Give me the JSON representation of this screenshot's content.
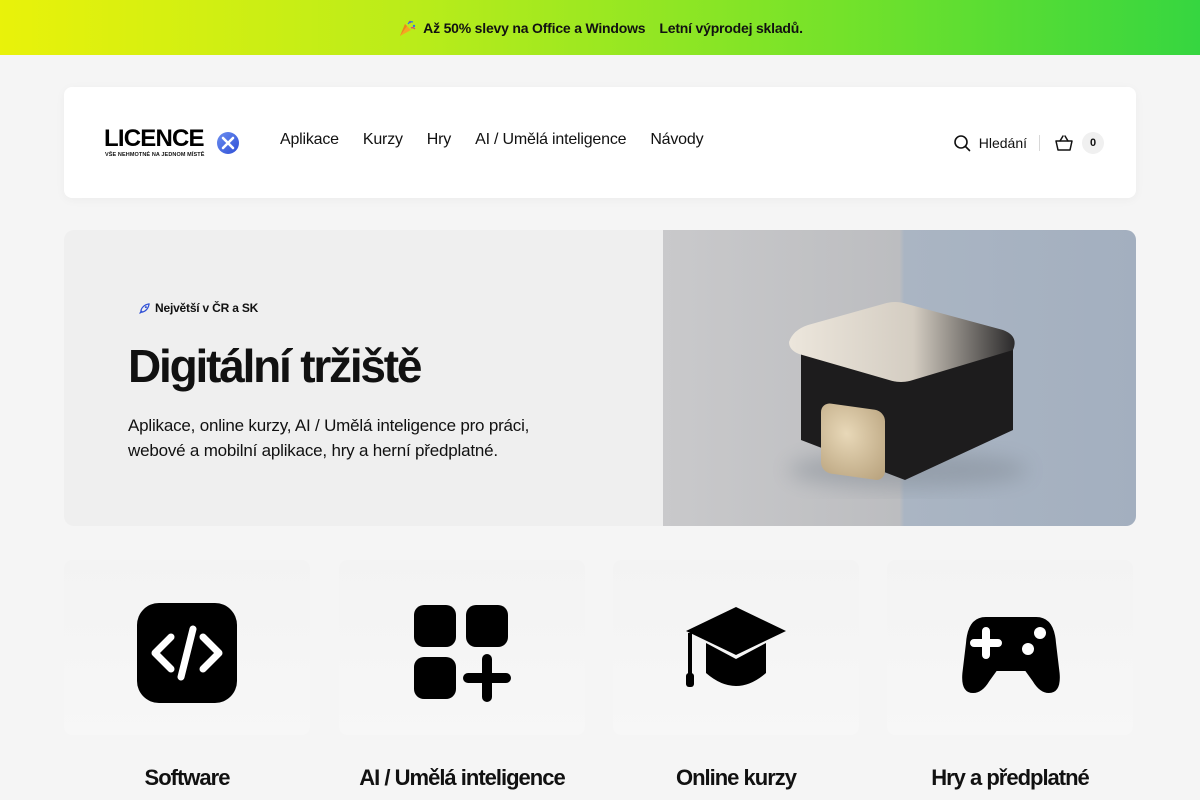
{
  "promo": {
    "offer": "Až 50% slevy na Office a Windows",
    "sale": "Letní výprodej skladů."
  },
  "header": {
    "logo": {
      "word": "LICENCE",
      "tagline": "VŠE NEHMOTNÉ NA JEDNOM MÍSTĚ"
    },
    "nav": [
      "Aplikace",
      "Kurzy",
      "Hry",
      "AI / Umělá inteligence",
      "Návody"
    ],
    "search_label": "Hledání",
    "cart_count": "0"
  },
  "hero": {
    "badge": "Největší v ČR a SK",
    "title": "Digitální tržiště",
    "description": "Aplikace, online kurzy, AI / Umělá inteligence pro práci, webové a mobilní aplikace, hry a herní předplatné."
  },
  "categories": [
    {
      "label": "Software",
      "icon": "code-icon"
    },
    {
      "label": "AI / Umělá inteligence",
      "icon": "apps-add-icon"
    },
    {
      "label": "Online kurzy",
      "icon": "graduation-cap-icon"
    },
    {
      "label": "Hry a předplatné",
      "icon": "gamepad-icon"
    }
  ]
}
